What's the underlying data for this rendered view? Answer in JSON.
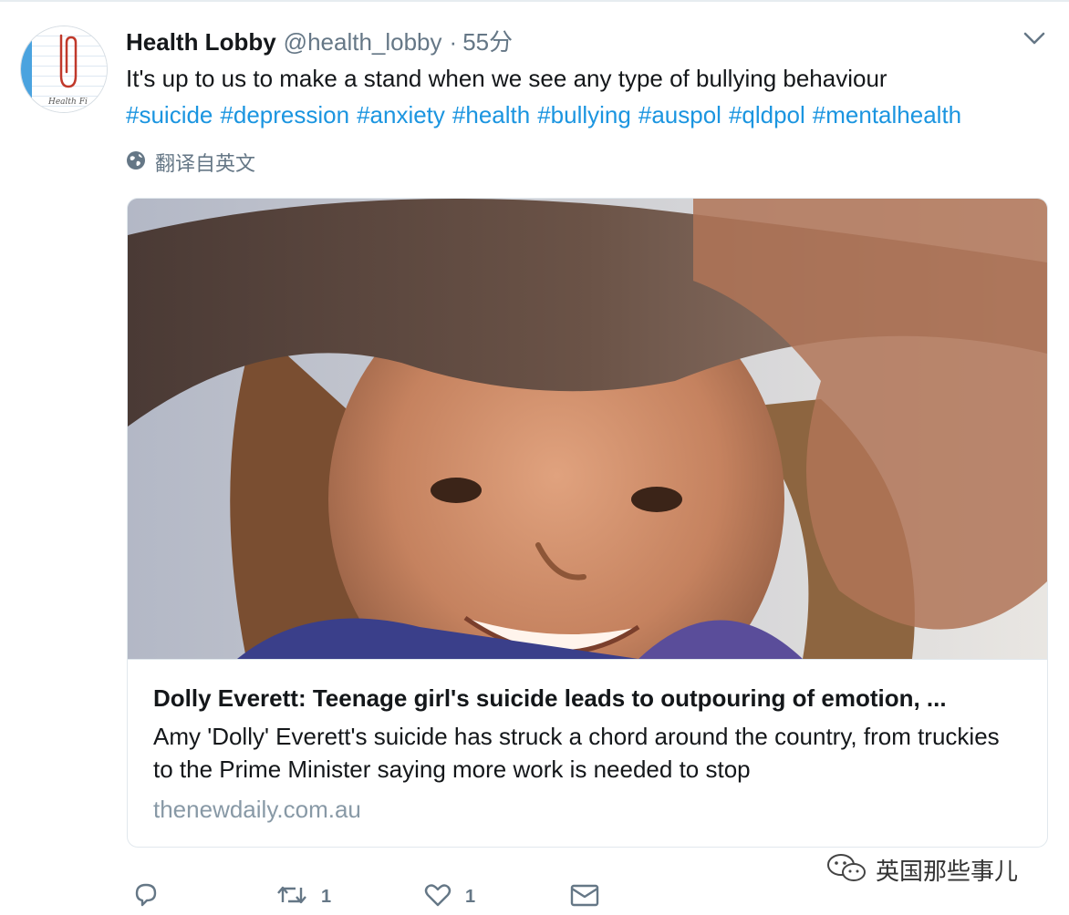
{
  "tweet": {
    "author_name": "Health Lobby",
    "author_handle": "@health_lobby",
    "separator": "·",
    "time": "55分",
    "text": "It's up to us to make a stand when we see any type of bullying behaviour",
    "hashtags": [
      "#suicide",
      "#depression",
      "#anxiety",
      "#health",
      "#bullying",
      "#auspol",
      "#qldpol",
      "#mentalhealth"
    ],
    "translate_label": "翻译自英文",
    "avatar_text": "Health Fi"
  },
  "card": {
    "title": "Dolly Everett: Teenage girl's suicide leads to outpouring of emotion, ...",
    "description": "Amy 'Dolly' Everett's suicide has struck a chord around the country, from truckies to the Prime Minister saying more work is needed to stop",
    "domain": "thenewdaily.com.au"
  },
  "actions": {
    "reply_count": "",
    "retweet_count": "1",
    "like_count": "1"
  },
  "watermark": {
    "text": "英国那些事儿"
  },
  "icons": {
    "avatar": "paperclip-notebook-avatar",
    "caret": "chevron-down-icon",
    "translate": "globe-icon",
    "reply": "reply-icon",
    "retweet": "retweet-icon",
    "like": "heart-icon",
    "message": "envelope-icon",
    "watermark": "wechat-icon"
  },
  "colors": {
    "link": "#1b95e0",
    "secondary_text": "#657786",
    "domain_text": "#8899a6"
  }
}
